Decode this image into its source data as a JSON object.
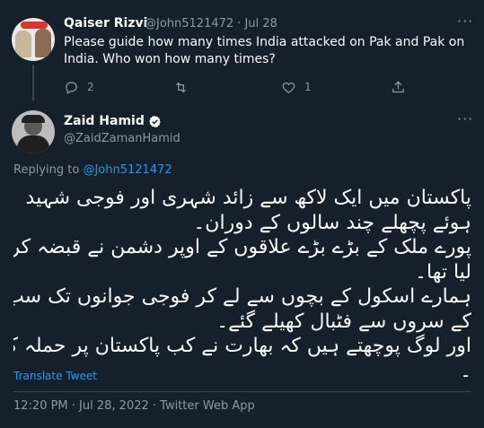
{
  "reply_tweet": {
    "author_name": "Qaiser Rizvi",
    "handle_date": "@John5121472 · Jul 28",
    "text": "Please guide how many times India attacked on Pak and Pak on India. Who won how many times?",
    "reply_count": "2",
    "retweet_count": "",
    "like_count": "1",
    "more_label": "···"
  },
  "main_tweet": {
    "author_name": "Zaid Hamid",
    "handle": "@ZaidZamanHamid",
    "more_label": "···",
    "replying_prefix": "Replying to ",
    "replying_to": "@John5121472",
    "lines": [
      "پاکستان میں ایک لاکھ سے زائد شہری اور فوجی شہید",
      "ہوئے پچھلے چند سالوں کے دوران۔",
      "پورے ملک کے بڑے بڑے علاقوں کے اوپر دشمن نے قبضہ کر",
      "لیا تھا۔",
      "ہمارے اسکول کے بچوں سے لے کر فوجی جوانوں تک سب",
      "کے سروں سے فٹبال کھیلے گئے۔",
      "اور لوگ پوچھتے ہیں کہ بھارت نے کب پاکستان پر حملہ کیا؟",
      "۔"
    ],
    "translate_label": "Translate Tweet",
    "timestamp": "12:20 PM · Jul 28, 2022 · Twitter Web App"
  },
  "colors": {
    "background": "#15202b",
    "text": "#f7f9f9",
    "secondary": "#8b98a5",
    "accent": "#1d9bf0",
    "divider": "#38444d"
  },
  "icons": [
    "reply-icon",
    "retweet-icon",
    "like-icon",
    "share-icon",
    "verified-badge-icon",
    "more-icon"
  ]
}
